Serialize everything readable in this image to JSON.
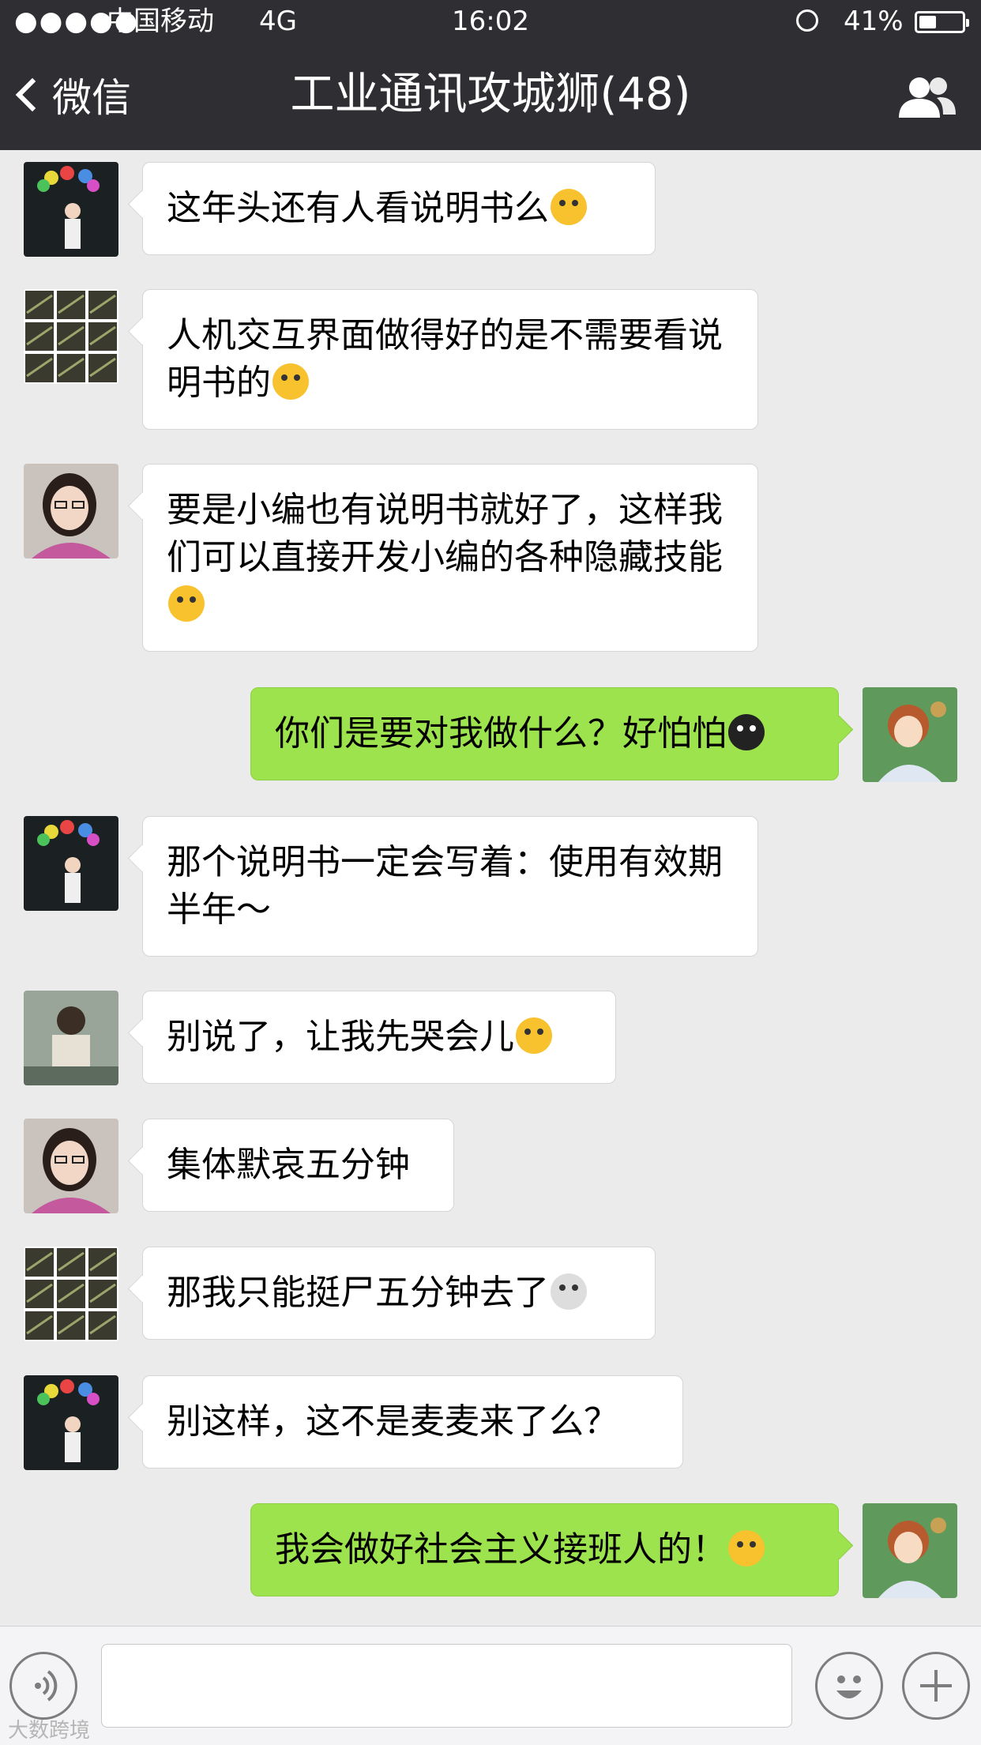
{
  "status_bar": {
    "signal": "●●●●●",
    "carrier": "中国移动",
    "network": "4G",
    "time": "16:02",
    "battery_percent": "41%",
    "battery_level": 0.41
  },
  "nav": {
    "back_label": "微信",
    "title": "工业通讯攻城狮(48)"
  },
  "messages": [
    {
      "side": "left",
      "text": "这年头还有人看说明书么",
      "emoji": "dizzy-face-emoji"
    },
    {
      "side": "left",
      "text": "人机交互界面做得好的是不需要看说明书的",
      "emoji": "kissing-face-emoji"
    },
    {
      "side": "left",
      "text": "要是小编也有说明书就好了，这样我们可以直接开发小编的各种隐藏技能",
      "emoji": "grimacing-face-emoji"
    },
    {
      "side": "right",
      "text": "你们是要对我做什么？好怕怕",
      "emoji": "scared-face-emoji"
    },
    {
      "side": "left",
      "text": "那个说明书一定会写着：使用有效期半年～",
      "emoji": ""
    },
    {
      "side": "left",
      "text": "别说了，让我先哭会儿",
      "emoji": "crying-face-emoji"
    },
    {
      "side": "left",
      "text": "集体默哀五分钟",
      "emoji": ""
    },
    {
      "side": "left",
      "text": "那我只能挺尸五分钟去了",
      "emoji": "skull-emoji"
    },
    {
      "side": "left",
      "text": "别这样，这不是麦麦来了么？",
      "emoji": ""
    },
    {
      "side": "right",
      "text": "我会做好社会主义接班人的！",
      "emoji": "determined-face-emoji"
    }
  ],
  "input": {
    "placeholder": ""
  },
  "watermark": "大数跨境",
  "colors": {
    "nav_bg": "#2e2e33",
    "chat_bg": "#ebebeb",
    "sent_bubble": "#9de34d",
    "received_bubble": "#ffffff"
  }
}
